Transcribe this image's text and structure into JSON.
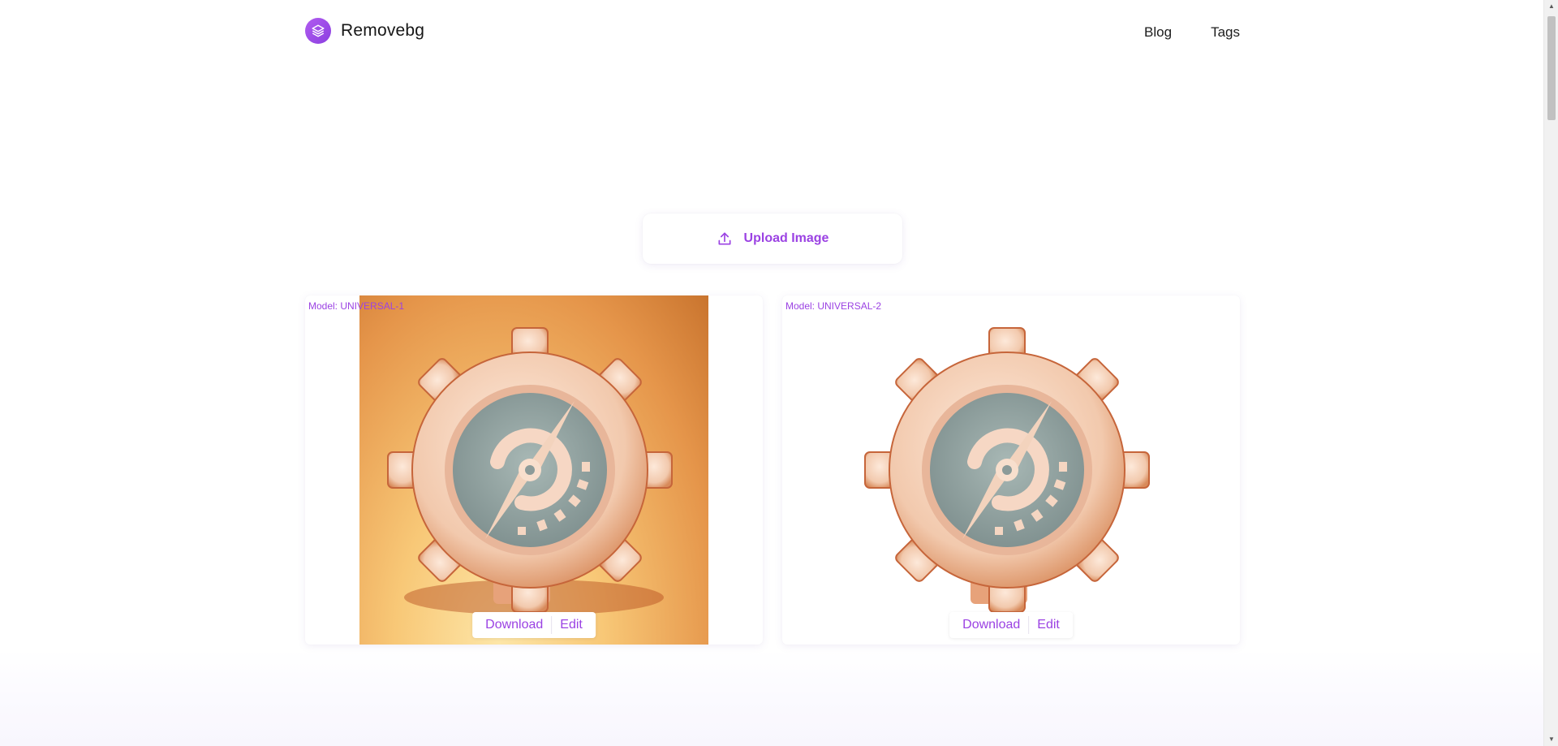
{
  "header": {
    "brand_name": "Removebg",
    "nav": [
      {
        "label": "Blog"
      },
      {
        "label": "Tags"
      }
    ]
  },
  "upload": {
    "label": "Upload Image"
  },
  "results": [
    {
      "model_label": "Model: UNIVERSAL-1",
      "download_label": "Download",
      "edit_label": "Edit"
    },
    {
      "model_label": "Model: UNIVERSAL-2",
      "download_label": "Download",
      "edit_label": "Edit"
    }
  ],
  "colors": {
    "accent": "#9b42e3",
    "brand_gradient_start": "#b15cf0",
    "brand_gradient_end": "#8b3fe0"
  },
  "icons": {
    "logo": "layers-icon",
    "upload": "upload-icon"
  }
}
